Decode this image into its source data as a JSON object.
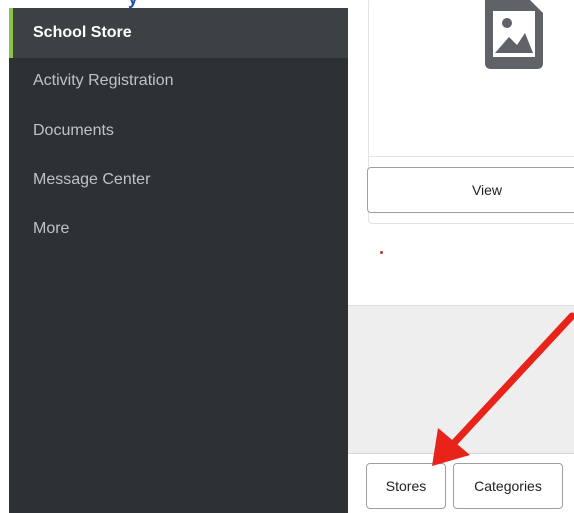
{
  "sidebar": {
    "items": [
      {
        "label": "School Store",
        "active": true
      },
      {
        "label": "Activity Registration",
        "active": false
      },
      {
        "label": "Documents",
        "active": false
      },
      {
        "label": "Message Center",
        "active": false
      },
      {
        "label": "More",
        "active": false
      }
    ],
    "active_accent": "#8bc34a",
    "background": "#2d3133"
  },
  "product_card": {
    "image_icon": "image-placeholder-icon",
    "view_label": "View"
  },
  "store_nav": {
    "stores_label": "Stores",
    "categories_label": "Categories"
  },
  "annotation": {
    "arrow_color": "#e8231a",
    "points_to": "Stores"
  }
}
